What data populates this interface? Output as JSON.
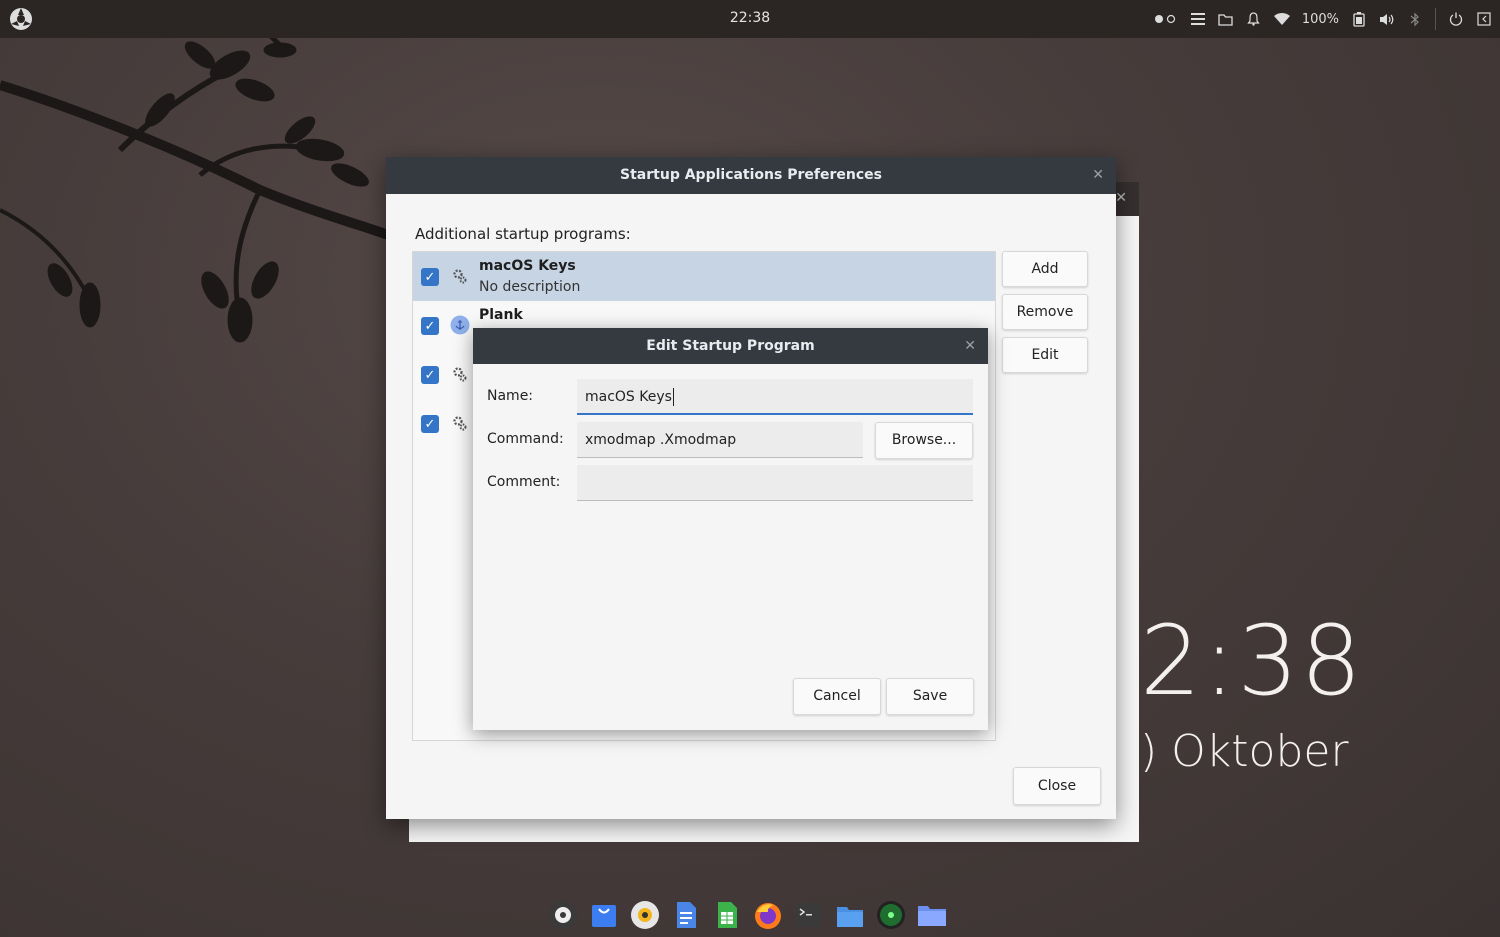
{
  "top_panel": {
    "time": "22:38",
    "battery_percent": "100%",
    "icons": [
      "distro-logo-icon",
      "workspace-dots-icon",
      "menu-icon",
      "folder-icon",
      "bell-icon",
      "wifi-icon",
      "battery-icon",
      "volume-icon",
      "bluetooth-icon",
      "power-icon",
      "logout-icon"
    ]
  },
  "desktop_widget": {
    "time_visible": "2:38",
    "date_visible": ") Oktober"
  },
  "main_window": {
    "title": "Startup Applications Preferences",
    "section_label": "Additional startup programs:",
    "programs": [
      {
        "name": "macOS Keys",
        "description": "No description",
        "checked": true,
        "selected": true,
        "icon": "gears-icon"
      },
      {
        "name": "Plank",
        "description": "",
        "checked": true,
        "selected": false,
        "icon": "plank-anchor-icon"
      },
      {
        "name": "",
        "description": "",
        "checked": true,
        "selected": false,
        "icon": "gears-icon"
      },
      {
        "name": "",
        "description": "",
        "checked": true,
        "selected": false,
        "icon": "gears-icon"
      }
    ],
    "buttons": {
      "add": "Add",
      "remove": "Remove",
      "edit": "Edit",
      "close": "Close"
    }
  },
  "edit_dialog": {
    "title": "Edit Startup Program",
    "name_label": "Name:",
    "name_value": "macOS Keys",
    "command_label": "Command:",
    "command_value": "xmodmap .Xmodmap",
    "browse_label": "Browse...",
    "comment_label": "Comment:",
    "comment_value": "",
    "cancel_label": "Cancel",
    "save_label": "Save"
  },
  "dock": {
    "items": [
      "distro-logo-icon",
      "software-store-icon",
      "music-player-icon",
      "text-document-icon",
      "spreadsheet-icon",
      "firefox-icon",
      "terminal-icon",
      "files-icon",
      "radar-app-icon",
      "folder-icon"
    ]
  },
  "colors": {
    "accent": "#3475c7",
    "titlebar": "#343a40",
    "selection": "#c6d4e3",
    "panel": "#2b2524"
  }
}
